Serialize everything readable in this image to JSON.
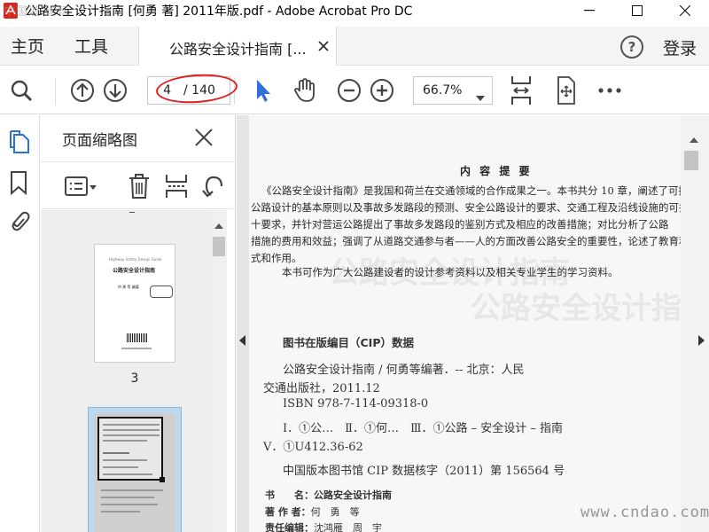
{
  "window": {
    "title": "公路安全设计指南 [何勇 著] 2011年版.pdf - Adobe Acrobat Pro DC",
    "watermark": "中国道·论坛"
  },
  "menu": {
    "home": "主页",
    "tools": "工具",
    "tab_label": "公路安全设计指南 [...",
    "login": "登录",
    "help": "?"
  },
  "toolbar": {
    "current_page": "4",
    "total_pages": "/ 140",
    "zoom": "66.7%"
  },
  "thumbnails": {
    "title": "页面缩略图",
    "page_labels": [
      "3"
    ],
    "page3_lines": [
      "Highway Safety Design Guide",
      "公路安全设计指南",
      "何 勇 等 编著"
    ]
  },
  "document": {
    "heading": "内 容 提 要",
    "paragraph_lines": [
      "《公路安全设计指南》是我国和荷兰在交通领域的合作成果之一。本书共分 10 章，阐述了可持",
      "公路设计的基本原则以及事故多发路段的预测、安全公路设计的要求、交通工程及沿线设施的可持",
      "十要求，并针对营运公路提出了事故多发路段的鉴别方式及相应的改善措施；对比分析了公路",
      "措施的费用和效益；强调了从道路交通参与者——人的方面改善公路安全的重要性，论述了教育和",
      "式和作用。",
      "　　本书可作为广大公路建设者的设计参考资料以及相关专业学生的学习资料。"
    ],
    "cip_heading": "图书在版编目（CIP）数据",
    "cip_lines": [
      "公路安全设计指南 / 何勇等编著．-- 北京：人民",
      "交通出版社，2011.12",
      "ISBN 978-7-114-09318-0",
      "Ⅰ．①公…　Ⅱ．①何…　Ⅲ．①公路 – 安全设计 – 指南",
      "Ⅴ．①U412.36-62",
      "中国版本图书馆 CIP 数据核字（2011）第 156564 号"
    ],
    "info_book_label": "书　　名：",
    "info_book_value": "公路安全设计指南",
    "info_author_label": "著 作 者：",
    "info_author_value": "何　勇　等",
    "info_editor_label": "责任编辑：",
    "info_editor_value": "沈鸿雁　周　宇",
    "site_watermark": "www.cndao.com",
    "ghost_title": "公路安全设计指南"
  },
  "colors": {
    "accent": "#2d6fd6",
    "annotation_red": "#e02020",
    "selected_thumb": "#bcd9ee"
  }
}
